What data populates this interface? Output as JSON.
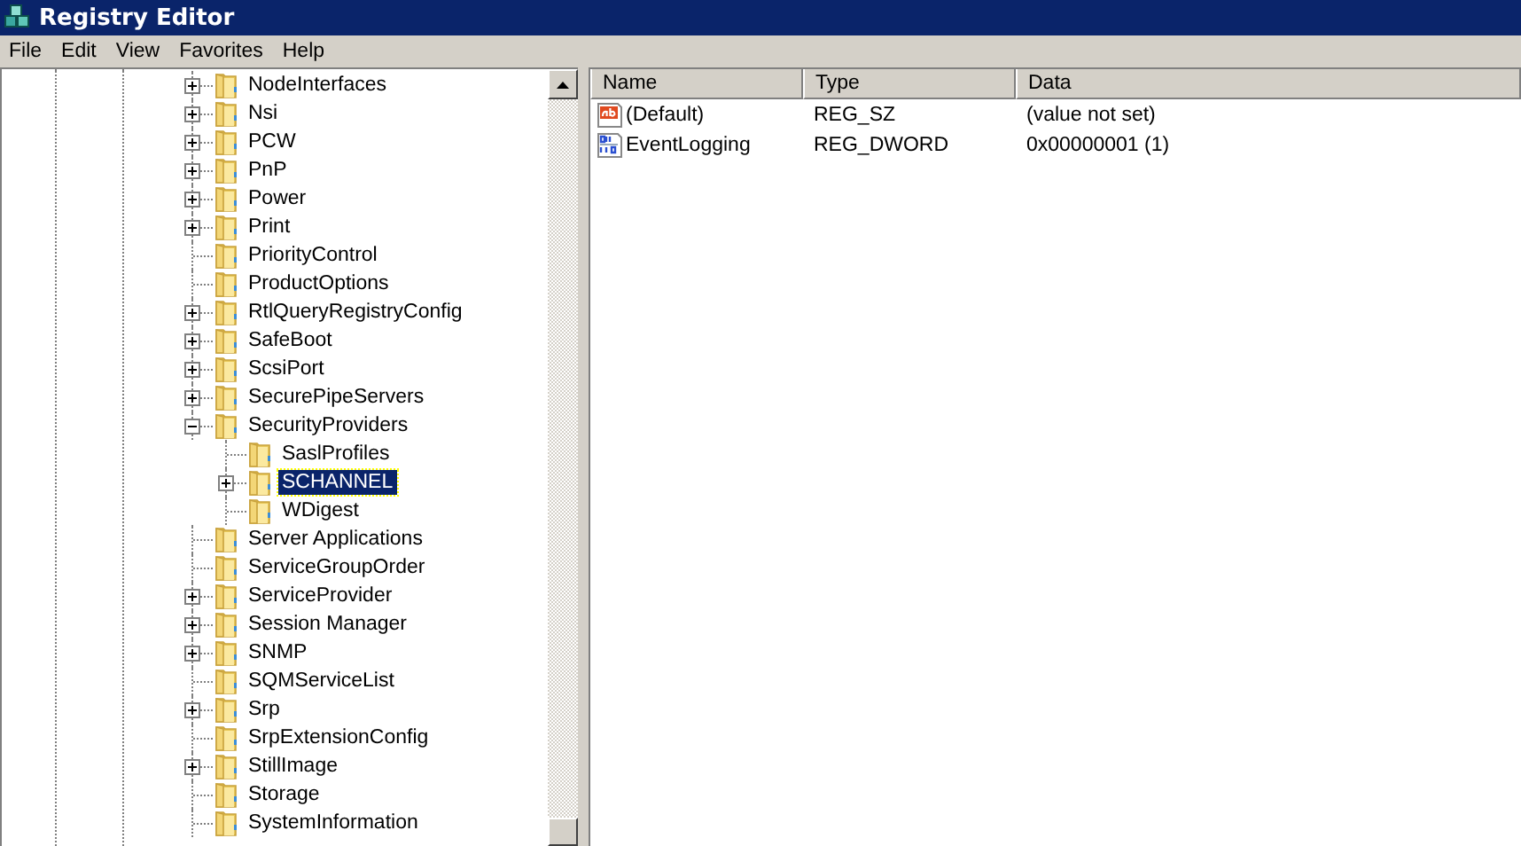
{
  "window": {
    "title": "Registry Editor"
  },
  "menu": [
    "File",
    "Edit",
    "View",
    "Favorites",
    "Help"
  ],
  "tree": [
    {
      "label": "NodeInterfaces",
      "expanded": false,
      "selected": false
    },
    {
      "label": "Nsi",
      "expanded": false,
      "selected": false
    },
    {
      "label": "PCW",
      "expanded": false,
      "selected": false
    },
    {
      "label": "PnP",
      "expanded": false,
      "selected": false
    },
    {
      "label": "Power",
      "expanded": false,
      "selected": false
    },
    {
      "label": "Print",
      "expanded": false,
      "selected": false
    },
    {
      "label": "PriorityControl",
      "selected": false
    },
    {
      "label": "ProductOptions",
      "selected": false
    },
    {
      "label": "RtlQueryRegistryConfig",
      "expanded": false,
      "selected": false
    },
    {
      "label": "SafeBoot",
      "expanded": false,
      "selected": false
    },
    {
      "label": "ScsiPort",
      "expanded": false,
      "selected": false
    },
    {
      "label": "SecurePipeServers",
      "expanded": false,
      "selected": false
    },
    {
      "label": "SecurityProviders",
      "expanded": true,
      "selected": false,
      "children": [
        {
          "label": "SaslProfiles",
          "selected": false
        },
        {
          "label": "SCHANNEL",
          "expanded": false,
          "selected": true
        },
        {
          "label": "WDigest",
          "selected": false
        }
      ]
    },
    {
      "label": "Server Applications",
      "selected": false
    },
    {
      "label": "ServiceGroupOrder",
      "selected": false
    },
    {
      "label": "ServiceProvider",
      "expanded": false,
      "selected": false
    },
    {
      "label": "Session Manager",
      "expanded": false,
      "selected": false
    },
    {
      "label": "SNMP",
      "expanded": false,
      "selected": false
    },
    {
      "label": "SQMServiceList",
      "selected": false
    },
    {
      "label": "Srp",
      "expanded": false,
      "selected": false
    },
    {
      "label": "SrpExtensionConfig",
      "selected": false
    },
    {
      "label": "StillImage",
      "expanded": false,
      "selected": false
    },
    {
      "label": "Storage",
      "selected": false
    },
    {
      "label": "SystemInformation",
      "selected": false
    }
  ],
  "values": {
    "columns": [
      "Name",
      "Type",
      "Data"
    ],
    "rows": [
      {
        "kind": "string",
        "name": "(Default)",
        "type": "REG_SZ",
        "data": "(value not set)"
      },
      {
        "kind": "dword",
        "name": "EventLogging",
        "type": "REG_DWORD",
        "data": "0x00000001 (1)"
      }
    ]
  }
}
